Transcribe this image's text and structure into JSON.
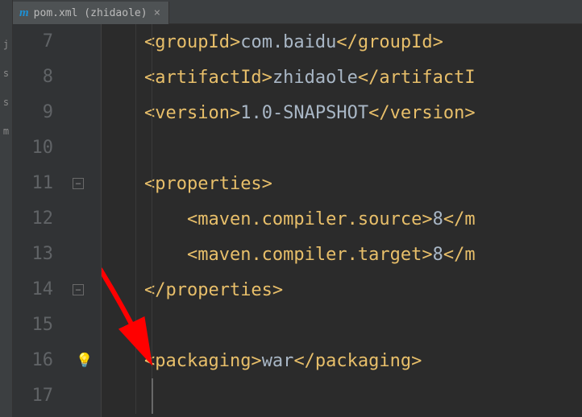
{
  "tab": {
    "filename": "pom.xml (zhidaole)",
    "icon_char": "m"
  },
  "gutter": {
    "lines": [
      "7",
      "8",
      "9",
      "10",
      "11",
      "12",
      "13",
      "14",
      "15",
      "16",
      "17"
    ]
  },
  "code": {
    "l7": {
      "prefix": "    ",
      "tag1": "<groupId>",
      "txt": "com.baidu",
      "tag2": "</groupId>"
    },
    "l8": {
      "prefix": "    ",
      "tag1": "<artifactId>",
      "txt": "zhidaole",
      "tag2": "</artifactI"
    },
    "l9": {
      "prefix": "    ",
      "tag1": "<version>",
      "txt": "1.0-SNAPSHOT",
      "tag2": "</version>"
    },
    "l10": {
      "prefix": ""
    },
    "l11": {
      "prefix": "    ",
      "tag1": "<properties>"
    },
    "l12": {
      "prefix": "        ",
      "tag1": "<maven.compiler.source>",
      "txt": "8",
      "tag2": "</m"
    },
    "l13": {
      "prefix": "        ",
      "tag1": "<maven.compiler.target>",
      "txt": "8",
      "tag2": "</m"
    },
    "l14": {
      "prefix": "    ",
      "tag1": "</properties>"
    },
    "l15": {
      "prefix": ""
    },
    "l16": {
      "prefix": "    ",
      "tag1": "<packaging>",
      "txt": "war",
      "tag2": "</packaging>"
    },
    "l17": {
      "prefix": ""
    }
  },
  "icons": {
    "bulb": "💡",
    "fold_minus": "−"
  },
  "sliver_chars": [
    "j",
    "s",
    "s",
    "m"
  ]
}
